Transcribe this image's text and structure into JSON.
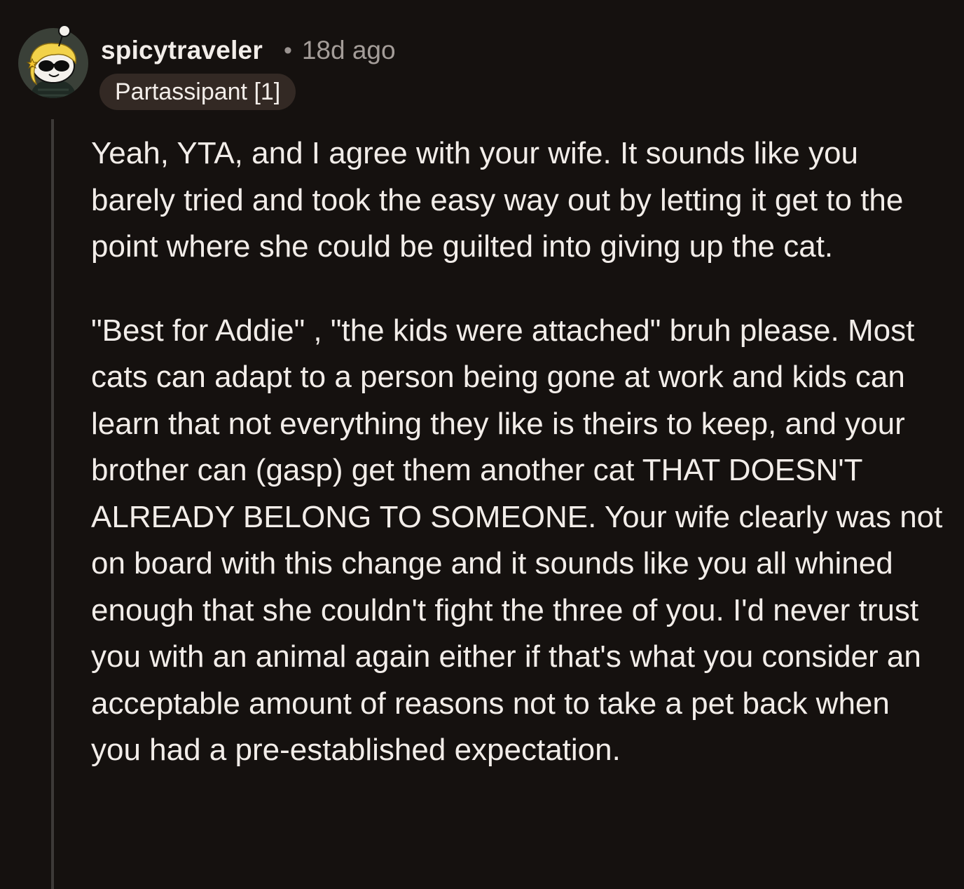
{
  "comment": {
    "author": "spicytraveler",
    "separator": "•",
    "timestamp": "18d ago",
    "flair": "Partassipant [1]",
    "avatar_icon": "snoo-avatar-with-sunglasses-icon",
    "paragraphs": [
      "Yeah, YTA, and I agree with your wife. It sounds like you barely tried and took the easy way out by letting it get to the point where she could be guilted into giving up the cat.",
      "\"Best for Addie\" , \"the kids were attached\" bruh please. Most cats can adapt to a person being gone at work and kids can learn that not everything they like is theirs to keep, and your brother can (gasp) get them another cat THAT DOESN'T ALREADY BELONG TO SOMEONE. Your wife clearly was not on board with this change and it sounds like you all whined enough that she couldn't fight the three of you. I'd never trust you with an animal again either if that's what you consider an acceptable amount of reasons not to take a pet back when you had a pre-established expectation."
    ]
  },
  "colors": {
    "background": "#15110f",
    "text": "#f2ede9",
    "muted_text": "#a49d99",
    "flair_background": "#332924",
    "thread_line": "#3d3a38"
  }
}
